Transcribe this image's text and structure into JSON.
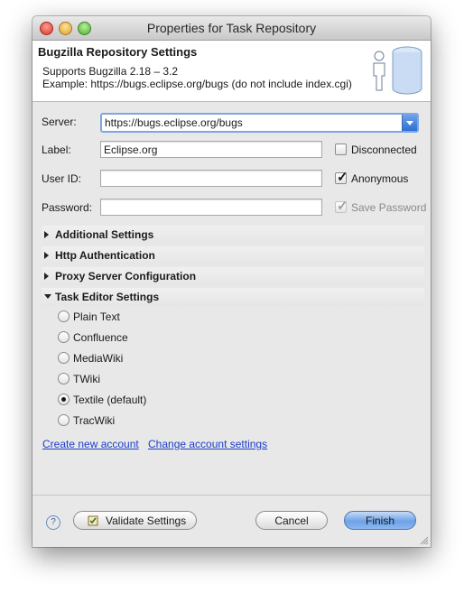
{
  "window": {
    "title": "Properties for Task Repository"
  },
  "header": {
    "title": "Bugzilla Repository Settings",
    "line1": "Supports Bugzilla 2.18 – 3.2",
    "line2": "Example: https://bugs.eclipse.org/bugs (do not include index.cgi)"
  },
  "form": {
    "server_label": "Server:",
    "server_value": "https://bugs.eclipse.org/bugs",
    "label_label": "Label:",
    "label_value": "Eclipse.org",
    "userid_label": "User ID:",
    "userid_value": "",
    "password_label": "Password:",
    "password_value": ""
  },
  "checkboxes": {
    "disconnected": {
      "label": "Disconnected",
      "checked": false
    },
    "anonymous": {
      "label": "Anonymous",
      "checked": true
    },
    "save_password": {
      "label": "Save Password",
      "checked": true,
      "disabled": true
    }
  },
  "sections": [
    {
      "label": "Additional Settings",
      "expanded": false
    },
    {
      "label": "Http Authentication",
      "expanded": false
    },
    {
      "label": "Proxy Server Configuration",
      "expanded": false
    },
    {
      "label": "Task Editor Settings",
      "expanded": true
    }
  ],
  "editor_options": [
    "Plain Text",
    "Confluence",
    "MediaWiki",
    "TWiki",
    "Textile (default)",
    "TracWiki"
  ],
  "editor_selected": "Textile (default)",
  "links": {
    "create_account": "Create new account",
    "change_settings": "Change account settings"
  },
  "buttons": {
    "help": "?",
    "validate": "Validate Settings",
    "cancel": "Cancel",
    "finish": "Finish"
  },
  "colors": {
    "link": "#1b3ec9",
    "primary_button": "#6ea2e6",
    "focus_ring": "#7ea6e0"
  }
}
